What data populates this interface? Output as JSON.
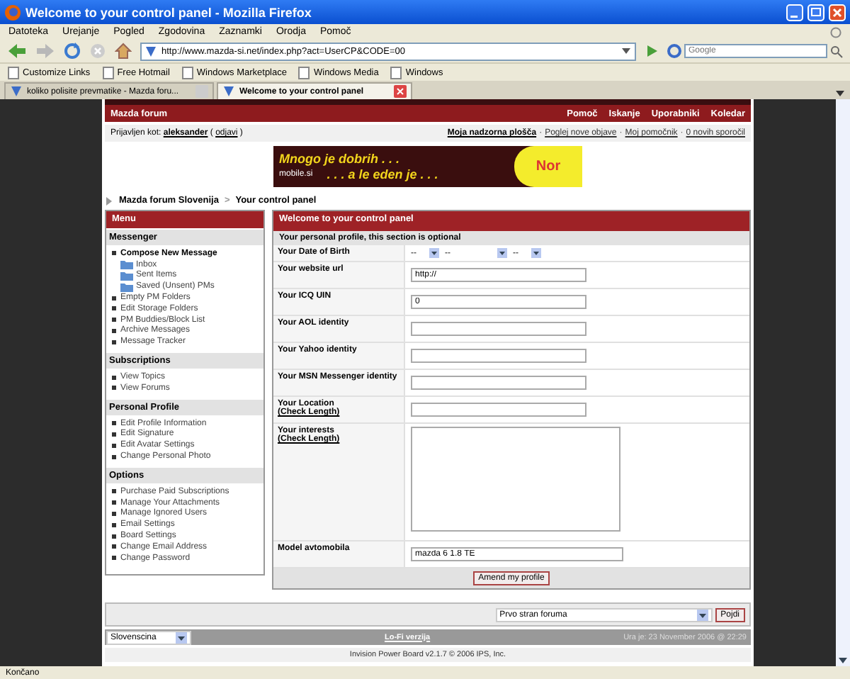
{
  "window": {
    "title": "Welcome to your control panel - Mozilla Firefox"
  },
  "menu_bar": [
    "Datoteka",
    "Urejanje",
    "Pogled",
    "Zgodovina",
    "Zaznamki",
    "Orodja",
    "Pomoč"
  ],
  "address_bar": {
    "url": "http://www.mazda-si.net/index.php?act=UserCP&CODE=00"
  },
  "search": {
    "placeholder": "Google"
  },
  "bookmarks": [
    "Customize Links",
    "Free Hotmail",
    "Windows Marketplace",
    "Windows Media",
    "Windows"
  ],
  "tabs": [
    {
      "label": "koliko polisite prevmatike - Mazda foru...",
      "selected": false
    },
    {
      "label": "Welcome to your control panel",
      "selected": true
    }
  ],
  "forum": {
    "title": "Mazda forum",
    "nav_links": [
      "Pomoč",
      "Iskanje",
      "Uporabniki",
      "Koledar"
    ],
    "login": {
      "prefix": "Prijavljen kot:",
      "user": "aleksander",
      "open": "(",
      "logout": "odjavi",
      "close": ")"
    },
    "link_separator": "·",
    "breadcrumb_separator": ">",
    "user_links": [
      {
        "label": "Moja nadzorna plošča",
        "bold": true
      },
      {
        "label": "Poglej nove objave",
        "bold": false
      },
      {
        "label": "Moj pomočnik",
        "bold": false
      },
      {
        "label": "0 novih sporočil",
        "bold": false
      }
    ],
    "banner": {
      "line1": "Mnogo je dobrih . . .",
      "line2": ". . . a le eden je . . .",
      "brand": "mobile.si",
      "badge": "Nor"
    },
    "breadcrumb": [
      "Mazda forum Slovenija",
      "Your control panel"
    ],
    "menu_title": "Menu",
    "sidebar": [
      {
        "title": "Messenger",
        "items": [
          {
            "label": "Compose New Message",
            "kind": "main"
          },
          {
            "label": "Inbox",
            "kind": "folder"
          },
          {
            "label": "Sent Items",
            "kind": "folder"
          },
          {
            "label": "Saved (Unsent) PMs",
            "kind": "folder"
          },
          {
            "label": "Empty PM Folders",
            "kind": "link"
          },
          {
            "label": "Edit Storage Folders",
            "kind": "link"
          },
          {
            "label": "PM Buddies/Block List",
            "kind": "link"
          },
          {
            "label": "Archive Messages",
            "kind": "link"
          },
          {
            "label": "Message Tracker",
            "kind": "link"
          }
        ]
      },
      {
        "title": "Subscriptions",
        "items": [
          {
            "label": "View Topics",
            "kind": "link"
          },
          {
            "label": "View Forums",
            "kind": "link"
          }
        ]
      },
      {
        "title": "Personal Profile",
        "items": [
          {
            "label": "Edit Profile Information",
            "kind": "link"
          },
          {
            "label": "Edit Signature",
            "kind": "link"
          },
          {
            "label": "Edit Avatar Settings",
            "kind": "link"
          },
          {
            "label": "Change Personal Photo",
            "kind": "link"
          }
        ]
      },
      {
        "title": "Options",
        "items": [
          {
            "label": "Purchase Paid Subscriptions",
            "kind": "link"
          },
          {
            "label": "Manage Your Attachments",
            "kind": "link"
          },
          {
            "label": "Manage Ignored Users",
            "kind": "link"
          },
          {
            "label": "Email Settings",
            "kind": "link"
          },
          {
            "label": "Board Settings",
            "kind": "link"
          },
          {
            "label": "Change Email Address",
            "kind": "link"
          },
          {
            "label": "Change Password",
            "kind": "link"
          }
        ]
      }
    ],
    "panel": {
      "title": "Welcome to your control panel",
      "subtitle": "Your personal profile, this section is optional",
      "fields": [
        {
          "label": "Your Date of Birth",
          "kind": "date",
          "values": [
            "--",
            "--",
            "--"
          ]
        },
        {
          "label": "Your website url",
          "kind": "text",
          "value": "http://"
        },
        {
          "label": "Your ICQ UIN",
          "kind": "text",
          "value": "0"
        },
        {
          "label": "Your AOL identity",
          "kind": "text"
        },
        {
          "label": "Your Yahoo identity",
          "kind": "text"
        },
        {
          "label": "Your MSN Messenger identity",
          "kind": "text"
        },
        {
          "label": "Your Location",
          "link": "(Check Length)",
          "kind": "text"
        },
        {
          "label": "Your interests",
          "link": "(Check Length)",
          "kind": "textarea"
        },
        {
          "label": "Model avtomobila",
          "kind": "wide",
          "value": "mazda 6 1.8 TE"
        }
      ],
      "submit": "Amend my profile"
    },
    "jump": {
      "value": "Prvo stran foruma",
      "button": "Pojdi"
    },
    "footer": {
      "language": "Slovenscina",
      "lofi": "Lo-Fi verzija",
      "time": "Ura je: 23 November 2006 @ 22:29"
    },
    "copyright": "Invision Power Board v2.1.7 © 2006  IPS, Inc."
  },
  "status_bar": "Končano"
}
